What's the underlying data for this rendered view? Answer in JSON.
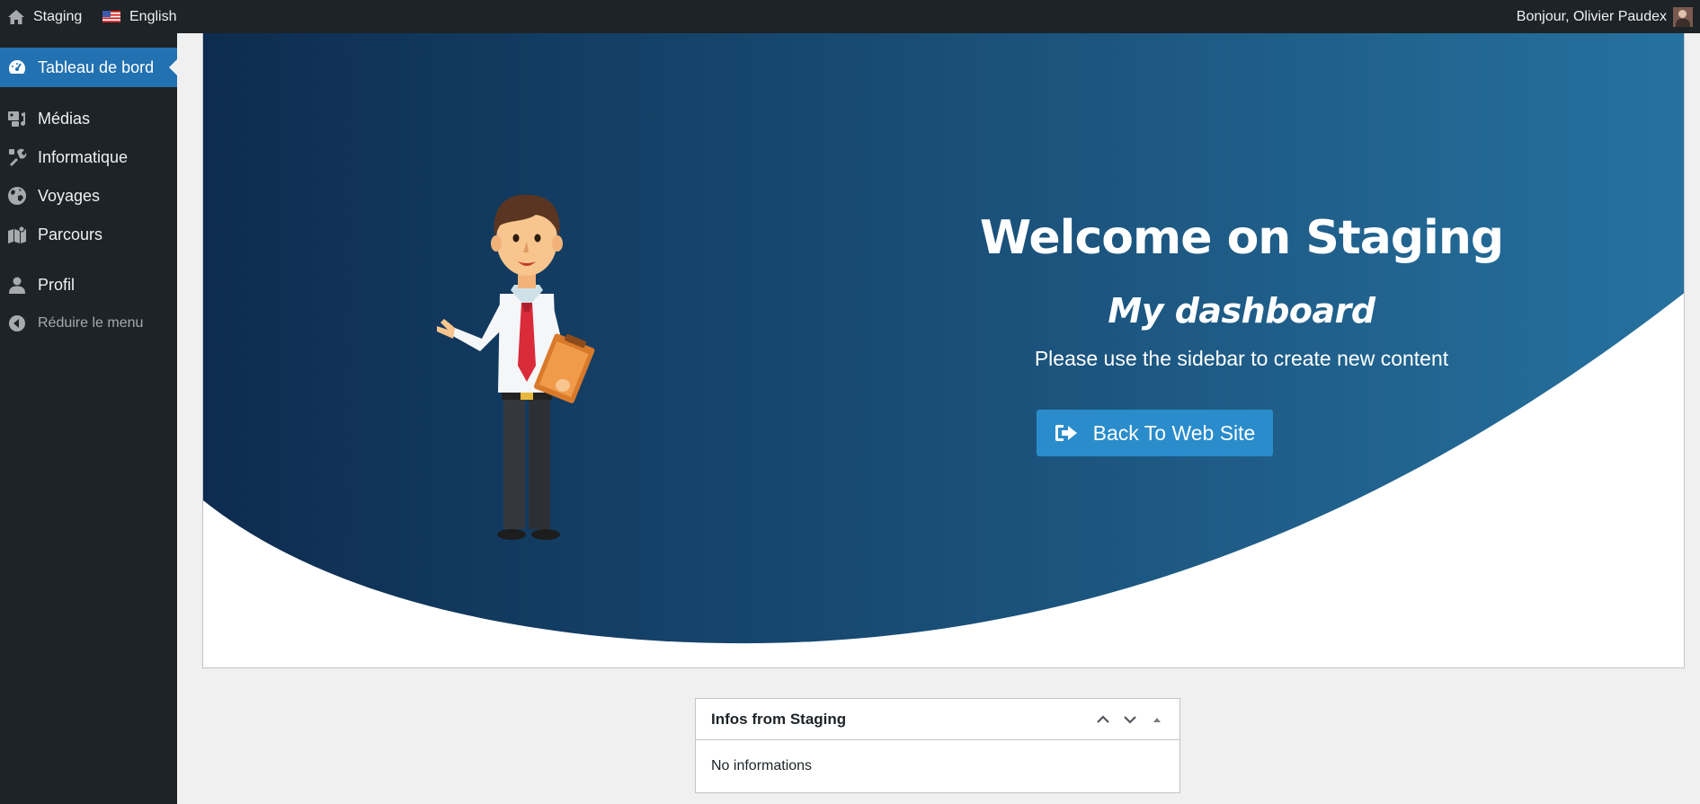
{
  "adminbar": {
    "site_name": "Staging",
    "language": "English",
    "greeting": "Bonjour, Olivier Paudex",
    "icons": {
      "home": "home-icon",
      "flag": "us-flag-icon",
      "avatar": "user-avatar"
    }
  },
  "sidebar": {
    "items": [
      {
        "label": "Tableau de bord",
        "icon": "dashboard-icon",
        "active": true
      },
      {
        "label": "Médias",
        "icon": "media-icon"
      },
      {
        "label": "Informatique",
        "icon": "tools-icon"
      },
      {
        "label": "Voyages",
        "icon": "globe-icon"
      },
      {
        "label": "Parcours",
        "icon": "map-icon"
      },
      {
        "label": "Profil",
        "icon": "user-icon"
      }
    ],
    "collapse_label": "Réduire le menu"
  },
  "welcome": {
    "title": "Welcome on Staging",
    "subtitle": "My dashboard",
    "text": "Please use the sidebar to create new content",
    "button_label": "Back To Web Site",
    "button_icon": "sign-out-icon"
  },
  "postbox": {
    "title": "Infos from Staging",
    "body": "No informations"
  },
  "colors": {
    "adminbar_bg": "#1d2327",
    "active_menu": "#2271b1",
    "hero_dark": "#0d2c4f",
    "hero_light": "#26719f",
    "button": "#2a8ccb"
  }
}
